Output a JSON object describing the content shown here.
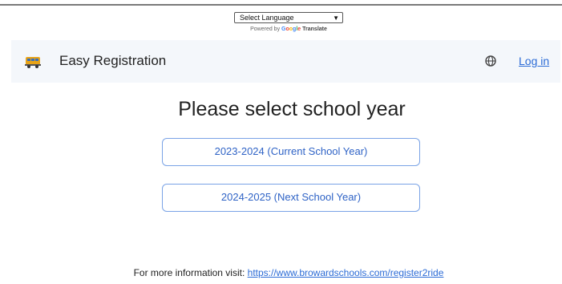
{
  "translate": {
    "select_label": "Select Language",
    "powered_prefix": "Powered by",
    "google_letters": [
      "G",
      "o",
      "o",
      "g",
      "l",
      "e"
    ],
    "google_colors": [
      "#4285F4",
      "#EA4335",
      "#FBBC05",
      "#4285F4",
      "#34A853",
      "#EA4335"
    ],
    "translate_label": "Translate"
  },
  "navbar": {
    "brand_icon": "school-bus-icon",
    "brand_title": "Easy Registration",
    "language_icon": "globe-icon",
    "login_label": "Log in",
    "link_color": "#2b6bd6"
  },
  "main": {
    "title": "Please select school year",
    "options": [
      {
        "label": "2023-2024 (Current School Year)"
      },
      {
        "label": "2024-2025 (Next School Year)"
      }
    ]
  },
  "footer": {
    "prefix": "For more information visit:",
    "link_text": "https://www.browardschools.com/register2ride"
  }
}
